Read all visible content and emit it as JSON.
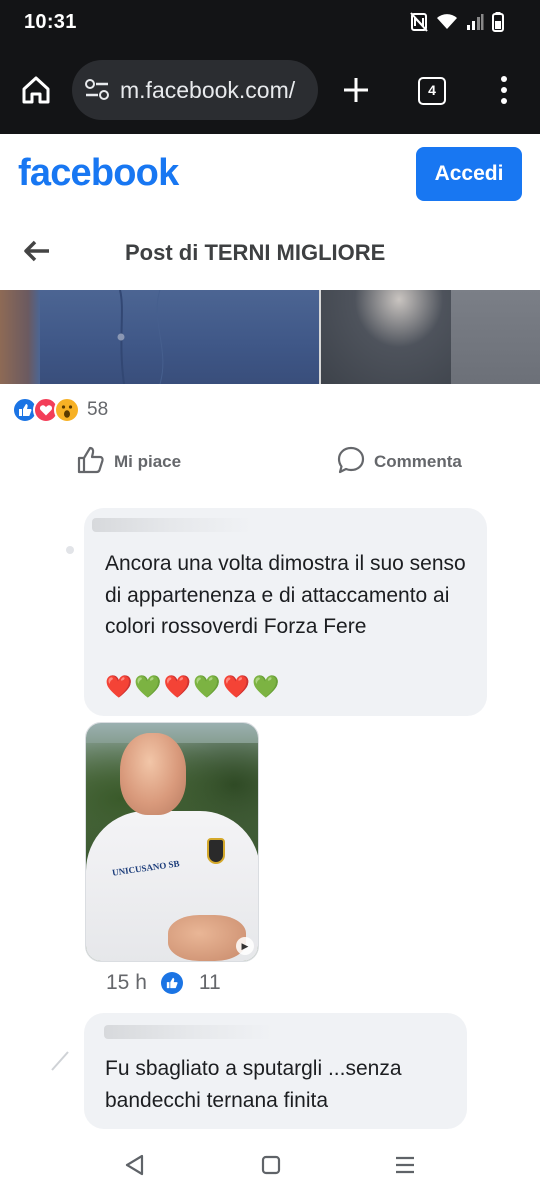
{
  "status_bar": {
    "time": "10:31"
  },
  "browser": {
    "url": "m.facebook.com/",
    "tab_count": "4",
    "icons": [
      "home-icon",
      "site-settings-icon",
      "new-tab-icon",
      "tabs-icon",
      "more-vert-icon"
    ]
  },
  "header": {
    "logo": "facebook",
    "login_label": "Accedi",
    "brand_color": "#1877f2"
  },
  "subheader": {
    "title": "Post di TERNI MIGLIORE"
  },
  "post": {
    "reaction_types": [
      "like",
      "love",
      "wow"
    ],
    "reaction_count": "58",
    "actions": {
      "like_label": "Mi piace",
      "comment_label": "Commenta"
    }
  },
  "comments": [
    {
      "text": "Ancora una volta dimostra il suo senso di appartenenza e di attaccamento ai colori rossoverdi Forza Fere",
      "emoji": "❤️💚❤️💚❤️💚",
      "attachment_text": "UNICUSANO SB",
      "time": "15 h",
      "likes": "11"
    },
    {
      "text": "Fu sbagliato a sputargli ...senza bandecchi ternana finita"
    }
  ]
}
